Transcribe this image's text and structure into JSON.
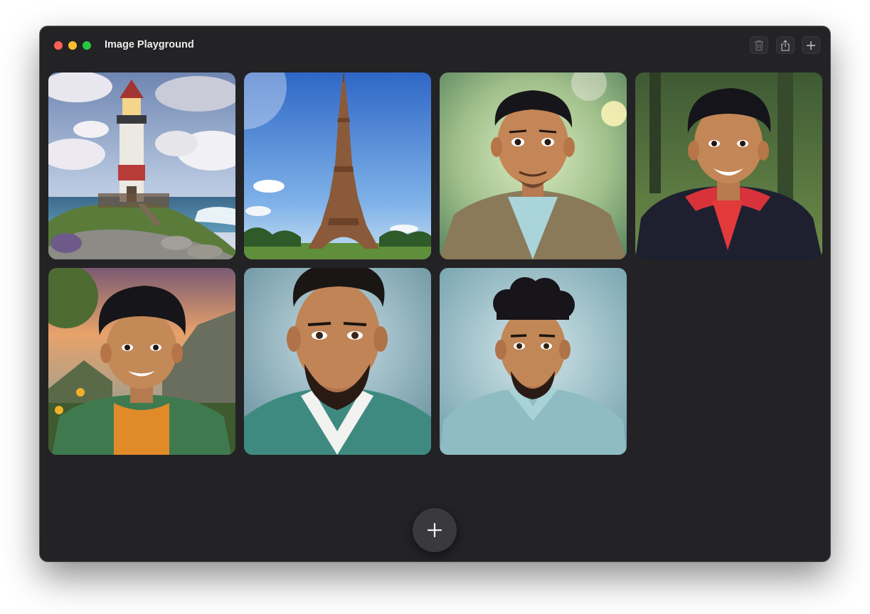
{
  "window": {
    "title": "Image Playground"
  },
  "toolbar": {
    "buttons": [
      {
        "icon": "trash-icon"
      },
      {
        "icon": "share-icon"
      },
      {
        "icon": "plus-icon"
      }
    ]
  },
  "gallery": {
    "images": [
      {
        "subject": "lighthouse"
      },
      {
        "subject": "eiffel-tower"
      },
      {
        "subject": "portrait-blazer"
      },
      {
        "subject": "portrait-hoodie"
      },
      {
        "subject": "portrait-green-jacket"
      },
      {
        "subject": "portrait-teal-jacket"
      },
      {
        "subject": "portrait-teal-shirt"
      }
    ]
  },
  "new_image_button": {
    "icon": "plus-icon"
  },
  "colors": {
    "window_bg": "#232225",
    "close": "#ff5f57",
    "minimize": "#febc2e",
    "maximize": "#28c840"
  }
}
